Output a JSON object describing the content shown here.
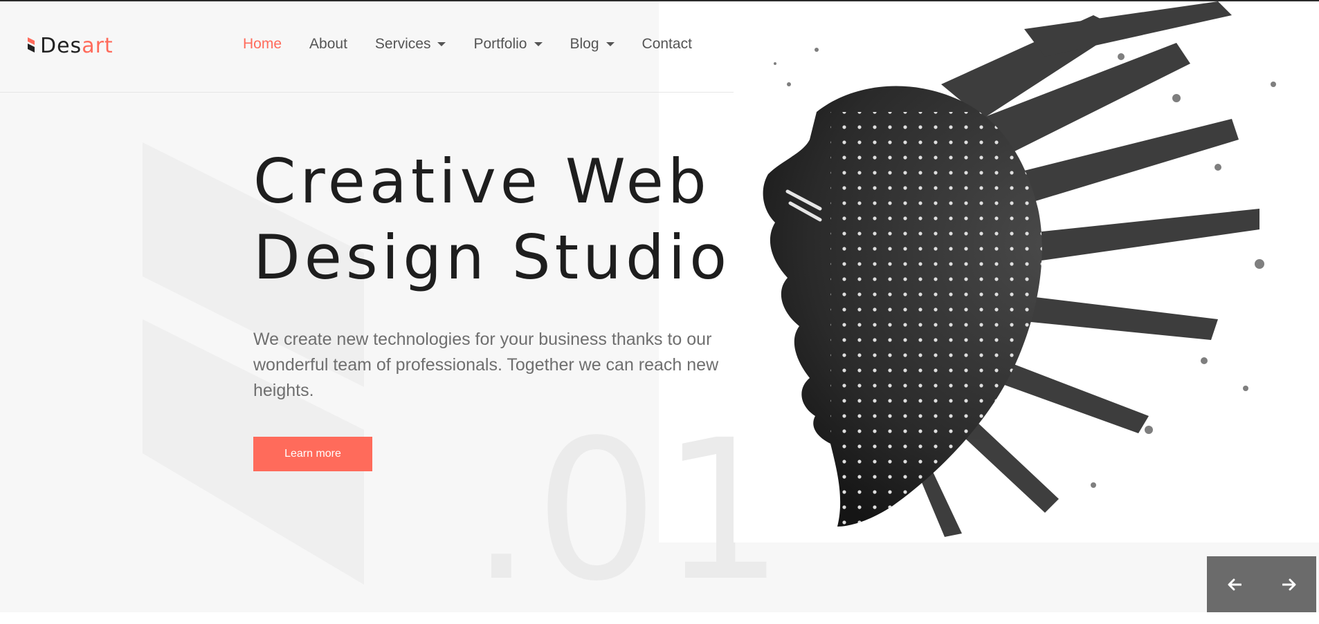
{
  "brand": {
    "name_primary": "Des",
    "name_accent": "art",
    "accent_color": "#ff6b5b"
  },
  "nav": {
    "items": [
      {
        "label": "Home",
        "active": true,
        "has_dropdown": false
      },
      {
        "label": "About",
        "active": false,
        "has_dropdown": false
      },
      {
        "label": "Services",
        "active": false,
        "has_dropdown": true
      },
      {
        "label": "Portfolio",
        "active": false,
        "has_dropdown": true
      },
      {
        "label": "Blog",
        "active": false,
        "has_dropdown": true
      },
      {
        "label": "Contact",
        "active": false,
        "has_dropdown": false
      }
    ],
    "search_icon": "search-icon"
  },
  "hero": {
    "title_line1": "Creative Web",
    "title_line2": "Design Studio",
    "description": "We create new technologies for your business thanks to our wonderful team of professionals. Together we can reach new heights.",
    "cta_label": "Learn more",
    "slide_number": ".01",
    "image": "tribal-face-portrait-ink-splash"
  },
  "slider": {
    "prev_icon": "arrow-left-icon",
    "next_icon": "arrow-right-icon"
  }
}
